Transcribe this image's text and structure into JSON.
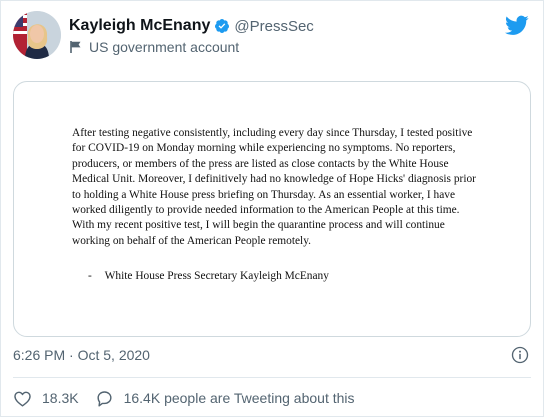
{
  "author": {
    "name": "Kayleigh McEnany",
    "handle": "@PressSec",
    "account_label": "US government account"
  },
  "statement": {
    "body": "After testing negative consistently, including every day since Thursday, I tested positive for COVID-19 on Monday morning while experiencing no symptoms.  No reporters, producers, or members of the press are listed as close contacts by the White House Medical Unit. Moreover, I definitively had no knowledge of Hope Hicks' diagnosis prior to holding a White House press briefing on Thursday. As an essential worker, I have worked diligently to provide needed information to the American People at this time. With my recent positive test, I will begin the quarantine process and will continue working on behalf of the American People remotely.",
    "dash": "-",
    "signature": "White House Press Secretary Kayleigh McEnany"
  },
  "timestamp": "6:26 PM · Oct 5, 2020",
  "likes": "18.3K",
  "conversation": "16.4K people are Tweeting about this",
  "colors": {
    "verified": "#1d9bf0",
    "muted_text": "#536471",
    "like_red": "#e0245e"
  },
  "icons": [
    "verified-badge-icon",
    "flag-icon",
    "twitter-bird-icon",
    "info-icon",
    "heart-icon",
    "speech-bubble-icon"
  ]
}
